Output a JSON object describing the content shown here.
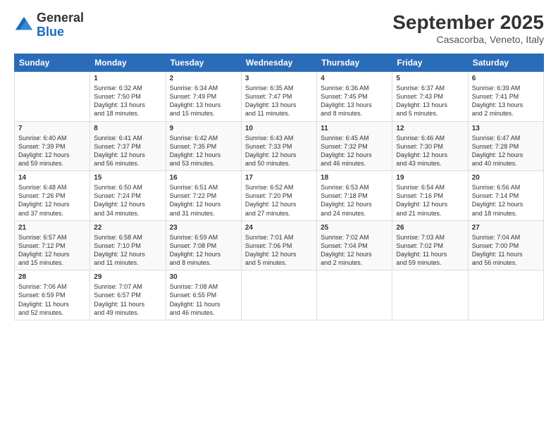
{
  "header": {
    "logo_general": "General",
    "logo_blue": "Blue",
    "month_title": "September 2025",
    "location": "Casacorba, Veneto, Italy"
  },
  "weekdays": [
    "Sunday",
    "Monday",
    "Tuesday",
    "Wednesday",
    "Thursday",
    "Friday",
    "Saturday"
  ],
  "weeks": [
    [
      {
        "day": "",
        "info": ""
      },
      {
        "day": "1",
        "info": "Sunrise: 6:32 AM\nSunset: 7:50 PM\nDaylight: 13 hours\nand 18 minutes."
      },
      {
        "day": "2",
        "info": "Sunrise: 6:34 AM\nSunset: 7:49 PM\nDaylight: 13 hours\nand 15 minutes."
      },
      {
        "day": "3",
        "info": "Sunrise: 6:35 AM\nSunset: 7:47 PM\nDaylight: 13 hours\nand 11 minutes."
      },
      {
        "day": "4",
        "info": "Sunrise: 6:36 AM\nSunset: 7:45 PM\nDaylight: 13 hours\nand 8 minutes."
      },
      {
        "day": "5",
        "info": "Sunrise: 6:37 AM\nSunset: 7:43 PM\nDaylight: 13 hours\nand 5 minutes."
      },
      {
        "day": "6",
        "info": "Sunrise: 6:39 AM\nSunset: 7:41 PM\nDaylight: 13 hours\nand 2 minutes."
      }
    ],
    [
      {
        "day": "7",
        "info": "Sunrise: 6:40 AM\nSunset: 7:39 PM\nDaylight: 12 hours\nand 59 minutes."
      },
      {
        "day": "8",
        "info": "Sunrise: 6:41 AM\nSunset: 7:37 PM\nDaylight: 12 hours\nand 56 minutes."
      },
      {
        "day": "9",
        "info": "Sunrise: 6:42 AM\nSunset: 7:35 PM\nDaylight: 12 hours\nand 53 minutes."
      },
      {
        "day": "10",
        "info": "Sunrise: 6:43 AM\nSunset: 7:33 PM\nDaylight: 12 hours\nand 50 minutes."
      },
      {
        "day": "11",
        "info": "Sunrise: 6:45 AM\nSunset: 7:32 PM\nDaylight: 12 hours\nand 46 minutes."
      },
      {
        "day": "12",
        "info": "Sunrise: 6:46 AM\nSunset: 7:30 PM\nDaylight: 12 hours\nand 43 minutes."
      },
      {
        "day": "13",
        "info": "Sunrise: 6:47 AM\nSunset: 7:28 PM\nDaylight: 12 hours\nand 40 minutes."
      }
    ],
    [
      {
        "day": "14",
        "info": "Sunrise: 6:48 AM\nSunset: 7:26 PM\nDaylight: 12 hours\nand 37 minutes."
      },
      {
        "day": "15",
        "info": "Sunrise: 6:50 AM\nSunset: 7:24 PM\nDaylight: 12 hours\nand 34 minutes."
      },
      {
        "day": "16",
        "info": "Sunrise: 6:51 AM\nSunset: 7:22 PM\nDaylight: 12 hours\nand 31 minutes."
      },
      {
        "day": "17",
        "info": "Sunrise: 6:52 AM\nSunset: 7:20 PM\nDaylight: 12 hours\nand 27 minutes."
      },
      {
        "day": "18",
        "info": "Sunrise: 6:53 AM\nSunset: 7:18 PM\nDaylight: 12 hours\nand 24 minutes."
      },
      {
        "day": "19",
        "info": "Sunrise: 6:54 AM\nSunset: 7:16 PM\nDaylight: 12 hours\nand 21 minutes."
      },
      {
        "day": "20",
        "info": "Sunrise: 6:56 AM\nSunset: 7:14 PM\nDaylight: 12 hours\nand 18 minutes."
      }
    ],
    [
      {
        "day": "21",
        "info": "Sunrise: 6:57 AM\nSunset: 7:12 PM\nDaylight: 12 hours\nand 15 minutes."
      },
      {
        "day": "22",
        "info": "Sunrise: 6:58 AM\nSunset: 7:10 PM\nDaylight: 12 hours\nand 11 minutes."
      },
      {
        "day": "23",
        "info": "Sunrise: 6:59 AM\nSunset: 7:08 PM\nDaylight: 12 hours\nand 8 minutes."
      },
      {
        "day": "24",
        "info": "Sunrise: 7:01 AM\nSunset: 7:06 PM\nDaylight: 12 hours\nand 5 minutes."
      },
      {
        "day": "25",
        "info": "Sunrise: 7:02 AM\nSunset: 7:04 PM\nDaylight: 12 hours\nand 2 minutes."
      },
      {
        "day": "26",
        "info": "Sunrise: 7:03 AM\nSunset: 7:02 PM\nDaylight: 11 hours\nand 59 minutes."
      },
      {
        "day": "27",
        "info": "Sunrise: 7:04 AM\nSunset: 7:00 PM\nDaylight: 11 hours\nand 56 minutes."
      }
    ],
    [
      {
        "day": "28",
        "info": "Sunrise: 7:06 AM\nSunset: 6:59 PM\nDaylight: 11 hours\nand 52 minutes."
      },
      {
        "day": "29",
        "info": "Sunrise: 7:07 AM\nSunset: 6:57 PM\nDaylight: 11 hours\nand 49 minutes."
      },
      {
        "day": "30",
        "info": "Sunrise: 7:08 AM\nSunset: 6:55 PM\nDaylight: 11 hours\nand 46 minutes."
      },
      {
        "day": "",
        "info": ""
      },
      {
        "day": "",
        "info": ""
      },
      {
        "day": "",
        "info": ""
      },
      {
        "day": "",
        "info": ""
      }
    ]
  ]
}
